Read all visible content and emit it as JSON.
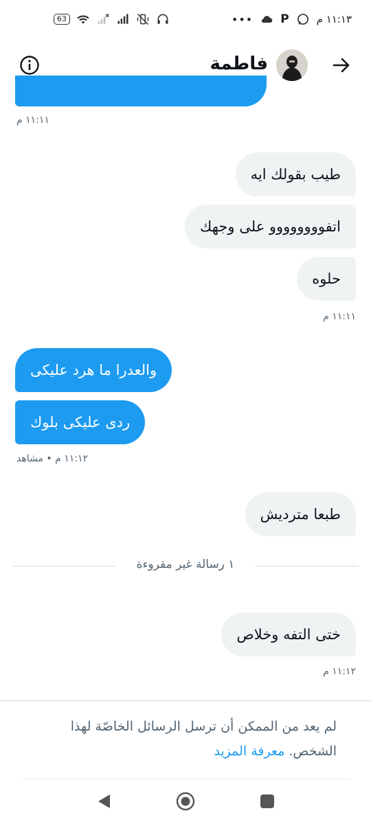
{
  "status_bar": {
    "time": "١١:١٣ م",
    "battery": "63"
  },
  "header": {
    "contact_name": "فاطمة"
  },
  "messages": [
    {
      "text": "طيب بقولك ايه"
    },
    {
      "text": "اتفوووووووو على وجهك"
    },
    {
      "text": "حلوه"
    },
    {
      "text": "والعدرا ما هرد عليكى"
    },
    {
      "text": "ردى عليكى بلوك"
    },
    {
      "text": "طبعا متردیش"
    },
    {
      "text": "ختى التفه وخلاص"
    }
  ],
  "timestamps": {
    "t1": "١١:١١ م",
    "t2": "١١:١١ م",
    "t3": "١١:١٢ م • مشاهد",
    "t4": "١١:١٢ م"
  },
  "divider": {
    "unread": "١ رسالة غير مقروءة"
  },
  "notice": {
    "text": "لم يعد من الممكن أن ترسل الرسائل الخاصّة لهذا الشخص.",
    "link": "معرفة المزيد"
  },
  "colors": {
    "accent": "#1d9bf0",
    "received_bubble": "#eff3f4",
    "muted": "#536471"
  }
}
